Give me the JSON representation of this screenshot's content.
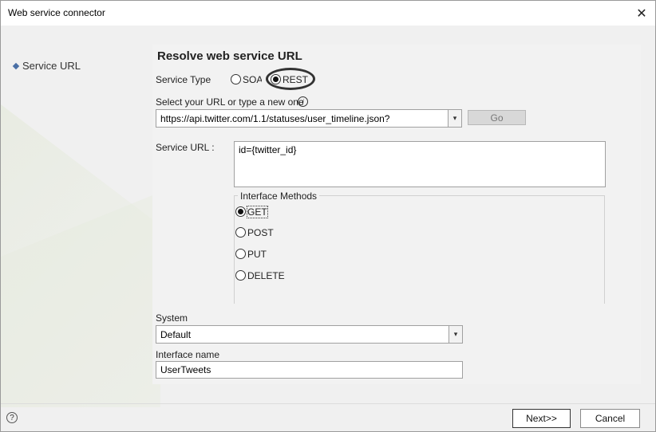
{
  "window": {
    "title": "Web service connector",
    "close_glyph": "✕"
  },
  "sidebar": {
    "items": [
      {
        "label": "Service URL",
        "icon": "diamond-bullet-icon"
      }
    ]
  },
  "main": {
    "heading": "Resolve web service URL",
    "service_type": {
      "label": "Service Type",
      "options": [
        {
          "label": "SOAP",
          "checked": false
        },
        {
          "label": "REST",
          "checked": true
        }
      ]
    },
    "url_select": {
      "label": "Select your URL or type a new one",
      "info_glyph": "i",
      "value": "https://api.twitter.com/1.1/statuses/user_timeline.json?",
      "arrow": "▾"
    },
    "go_button": "Go",
    "service_url": {
      "label": "Service URL :",
      "value": "id={twitter_id}"
    },
    "interface_methods": {
      "title": "Interface Methods",
      "options": [
        {
          "label": "GET",
          "checked": true
        },
        {
          "label": "POST",
          "checked": false
        },
        {
          "label": "PUT",
          "checked": false
        },
        {
          "label": "DELETE",
          "checked": false
        }
      ]
    },
    "system": {
      "label": "System",
      "value": "Default",
      "arrow": "▾"
    },
    "interface_name": {
      "label": "Interface name",
      "value": "UserTweets"
    }
  },
  "footer": {
    "help_glyph": "?",
    "next_label": "Next>>",
    "cancel_label": "Cancel"
  }
}
